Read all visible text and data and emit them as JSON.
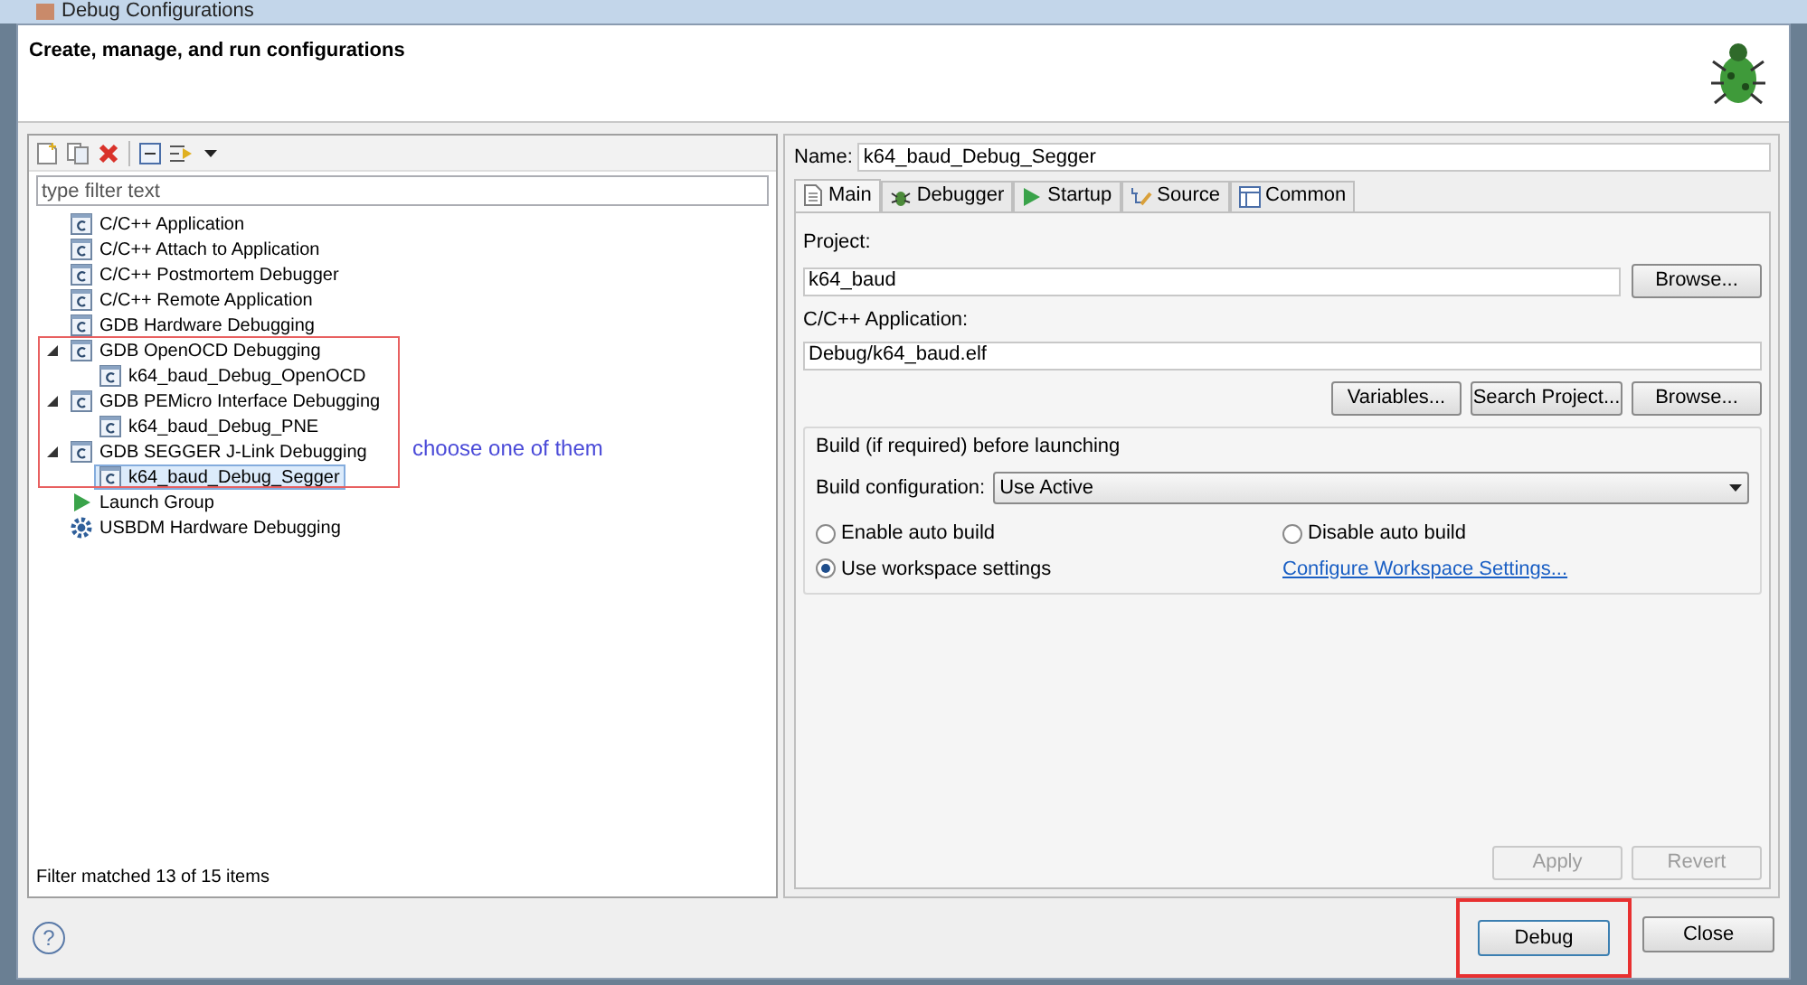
{
  "window": {
    "title": "Debug Configurations"
  },
  "header": {
    "title": "Create, manage, and run configurations"
  },
  "filter": {
    "placeholder": "type filter text"
  },
  "tree": [
    {
      "label": "C/C++ Application",
      "kind": "c",
      "selected": false
    },
    {
      "label": "C/C++ Attach to Application",
      "kind": "c",
      "selected": false
    },
    {
      "label": "C/C++ Postmortem Debugger",
      "kind": "c",
      "selected": false
    },
    {
      "label": "C/C++ Remote Application",
      "kind": "c",
      "selected": false
    },
    {
      "label": "GDB Hardware Debugging",
      "kind": "c",
      "selected": false
    },
    {
      "label": "GDB OpenOCD Debugging",
      "kind": "c",
      "selected": false,
      "expanded": true,
      "children": [
        {
          "label": "k64_baud_Debug_OpenOCD",
          "kind": "c",
          "selected": false
        }
      ]
    },
    {
      "label": "GDB PEMicro Interface Debugging",
      "kind": "c",
      "selected": false,
      "expanded": true,
      "children": [
        {
          "label": "k64_baud_Debug_PNE",
          "kind": "c",
          "selected": false
        }
      ]
    },
    {
      "label": "GDB SEGGER J-Link Debugging",
      "kind": "c",
      "selected": false,
      "expanded": true,
      "children": [
        {
          "label": "k64_baud_Debug_Segger",
          "kind": "c",
          "selected": true
        }
      ]
    },
    {
      "label": "Launch Group",
      "kind": "launch",
      "selected": false
    },
    {
      "label": "USBDM Hardware Debugging",
      "kind": "gear",
      "selected": false
    }
  ],
  "annotation": "choose one of them",
  "filter_status": "Filter matched 13 of 15 items",
  "name": {
    "label": "Name:",
    "value": "k64_baud_Debug_Segger"
  },
  "tabs": [
    {
      "label": "Main",
      "kind": "main",
      "selected": true
    },
    {
      "label": "Debugger",
      "kind": "bug",
      "selected": false
    },
    {
      "label": "Startup",
      "kind": "play",
      "selected": false
    },
    {
      "label": "Source",
      "kind": "source",
      "selected": false
    },
    {
      "label": "Common",
      "kind": "common",
      "selected": false
    }
  ],
  "project": {
    "label": "Project:",
    "value": "k64_baud",
    "button": "Browse..."
  },
  "application": {
    "label": "C/C++ Application:",
    "value": "Debug/k64_baud.elf",
    "buttons": [
      "Variables...",
      "Search Project...",
      "Browse..."
    ]
  },
  "build": {
    "title": "Build (if required) before launching",
    "config_label": "Build configuration:",
    "config_value": "Use Active",
    "radios": [
      {
        "label": "Enable auto build",
        "selected": false
      },
      {
        "label": "Disable auto build",
        "selected": false
      },
      {
        "label": "Use workspace settings",
        "selected": true
      }
    ],
    "link": "Configure Workspace Settings..."
  },
  "panel_buttons": [
    {
      "label": "Apply",
      "disabled": true
    },
    {
      "label": "Revert",
      "disabled": true
    }
  ],
  "help": "?",
  "dialog_buttons": [
    {
      "label": "Debug",
      "highlighted": true
    },
    {
      "label": "Close",
      "highlighted": false
    }
  ]
}
